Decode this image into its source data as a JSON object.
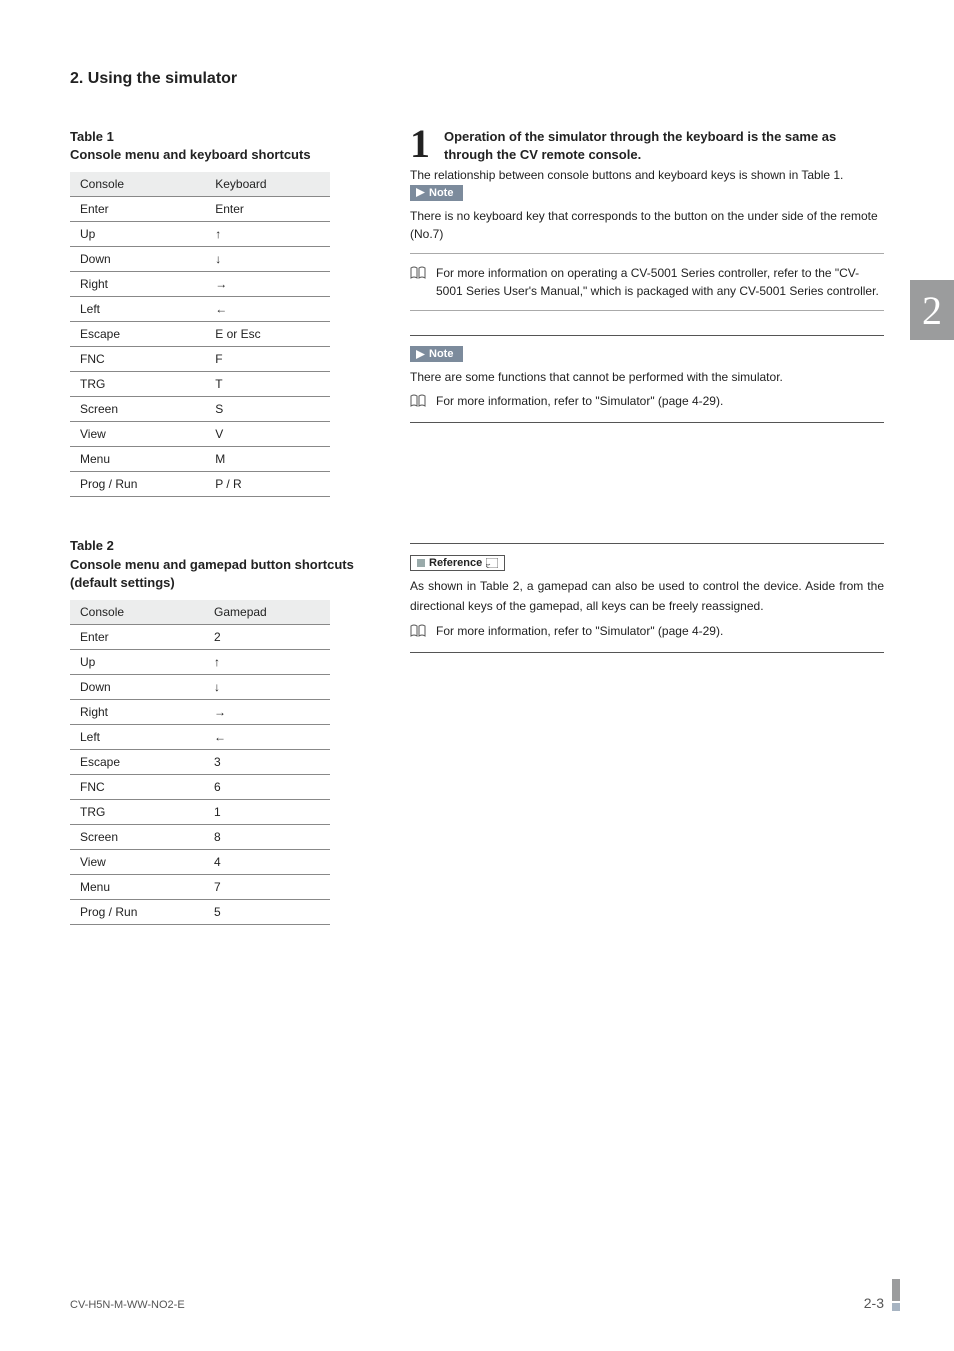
{
  "section_heading": "2. Using the simulator",
  "thumb_tab": "2",
  "table1": {
    "label": "Table 1",
    "title": "Console menu and keyboard shortcuts",
    "headers": [
      "Console",
      "Keyboard"
    ],
    "rows": [
      [
        "Enter",
        "Enter"
      ],
      [
        "Up",
        "↑"
      ],
      [
        "Down",
        "↓"
      ],
      [
        "Right",
        "→"
      ],
      [
        "Left",
        "←"
      ],
      [
        "Escape",
        "E or Esc"
      ],
      [
        "FNC",
        "F"
      ],
      [
        "TRG",
        "T"
      ],
      [
        "Screen",
        "S"
      ],
      [
        "View",
        "V"
      ],
      [
        "Menu",
        "M"
      ],
      [
        "Prog / Run",
        "P / R"
      ]
    ]
  },
  "table2": {
    "label": "Table 2",
    "title": "Console menu and gamepad button shortcuts (default settings)",
    "headers": [
      "Console",
      "Gamepad"
    ],
    "rows": [
      [
        "Enter",
        "2"
      ],
      [
        "Up",
        "↑"
      ],
      [
        "Down",
        "↓"
      ],
      [
        "Right",
        "→"
      ],
      [
        "Left",
        "←"
      ],
      [
        "Escape",
        "3"
      ],
      [
        "FNC",
        "6"
      ],
      [
        "TRG",
        "1"
      ],
      [
        "Screen",
        "8"
      ],
      [
        "View",
        "4"
      ],
      [
        "Menu",
        "7"
      ],
      [
        "Prog / Run",
        "5"
      ]
    ]
  },
  "right": {
    "step_num": "1",
    "step_text": "Operation of the simulator through the keyboard is the same as through the CV remote console.",
    "intro": "The relationship between console buttons and keyboard keys is shown in Table 1.",
    "note_label": "Note",
    "note1_text": "There is no keyboard key that corresponds to the button on the under side of the remote (No.7)",
    "note1_ref": "For more information on operating a CV-5001 Series controller, refer to the \"CV-5001 Series User's Manual,\" which is packaged with any CV-5001 Series controller.",
    "note2_text": "There are some functions that cannot be performed with the simulator.",
    "note2_ref": "For more information, refer to \"Simulator\" (page 4-29).",
    "reference_label": "Reference",
    "reference_text": "As shown in Table 2, a gamepad can also be used to control the device. Aside from the directional keys of the gamepad, all keys can be freely reassigned.",
    "reference_ref": "For more information, refer to \"Simulator\" (page 4-29)."
  },
  "footer": {
    "doc_code": "CV-H5N-M-WW-NO2-E",
    "page": "2-3"
  }
}
